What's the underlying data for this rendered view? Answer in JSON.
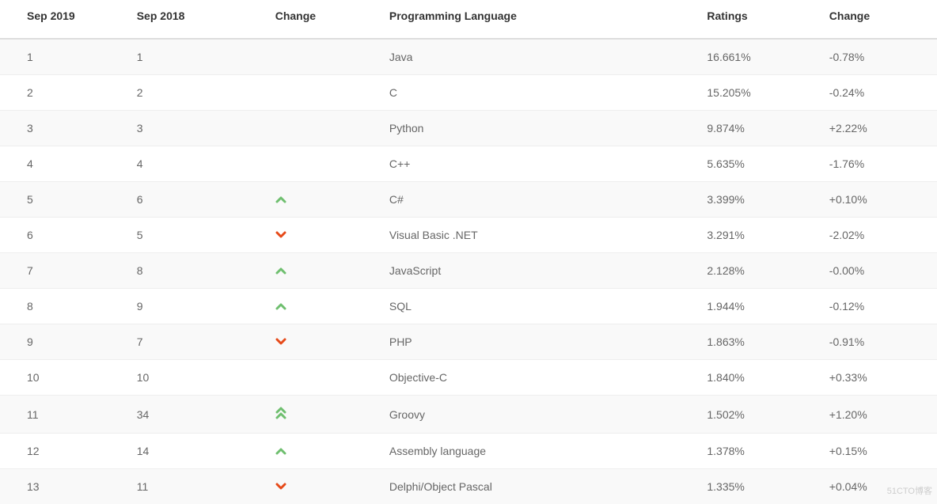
{
  "headers": {
    "sep2019": "Sep 2019",
    "sep2018": "Sep 2018",
    "change_icon": "Change",
    "language": "Programming Language",
    "ratings": "Ratings",
    "change": "Change"
  },
  "rows": [
    {
      "rank2019": "1",
      "rank2018": "1",
      "trend": "",
      "language": "Java",
      "ratings": "16.661%",
      "change": "-0.78%"
    },
    {
      "rank2019": "2",
      "rank2018": "2",
      "trend": "",
      "language": "C",
      "ratings": "15.205%",
      "change": "-0.24%"
    },
    {
      "rank2019": "3",
      "rank2018": "3",
      "trend": "",
      "language": "Python",
      "ratings": "9.874%",
      "change": "+2.22%"
    },
    {
      "rank2019": "4",
      "rank2018": "4",
      "trend": "",
      "language": "C++",
      "ratings": "5.635%",
      "change": "-1.76%"
    },
    {
      "rank2019": "5",
      "rank2018": "6",
      "trend": "up",
      "language": "C#",
      "ratings": "3.399%",
      "change": "+0.10%"
    },
    {
      "rank2019": "6",
      "rank2018": "5",
      "trend": "down",
      "language": "Visual Basic .NET",
      "ratings": "3.291%",
      "change": "-2.02%"
    },
    {
      "rank2019": "7",
      "rank2018": "8",
      "trend": "up",
      "language": "JavaScript",
      "ratings": "2.128%",
      "change": "-0.00%"
    },
    {
      "rank2019": "8",
      "rank2018": "9",
      "trend": "up",
      "language": "SQL",
      "ratings": "1.944%",
      "change": "-0.12%"
    },
    {
      "rank2019": "9",
      "rank2018": "7",
      "trend": "down",
      "language": "PHP",
      "ratings": "1.863%",
      "change": "-0.91%"
    },
    {
      "rank2019": "10",
      "rank2018": "10",
      "trend": "",
      "language": "Objective-C",
      "ratings": "1.840%",
      "change": "+0.33%"
    },
    {
      "rank2019": "11",
      "rank2018": "34",
      "trend": "double-up",
      "language": "Groovy",
      "ratings": "1.502%",
      "change": "+1.20%"
    },
    {
      "rank2019": "12",
      "rank2018": "14",
      "trend": "up",
      "language": "Assembly language",
      "ratings": "1.378%",
      "change": "+0.15%"
    },
    {
      "rank2019": "13",
      "rank2018": "11",
      "trend": "down",
      "language": "Delphi/Object Pascal",
      "ratings": "1.335%",
      "change": "+0.04%"
    }
  ],
  "colors": {
    "up": "#6fbf6f",
    "down": "#e64a19"
  },
  "watermark": "51CTO博客"
}
